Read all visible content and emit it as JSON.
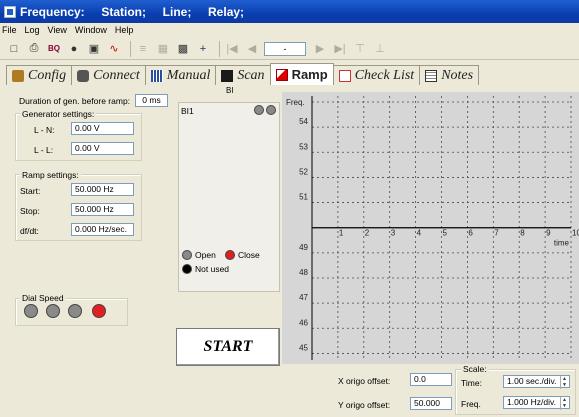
{
  "window": {
    "title": "Frequency:     Station;     Line;     Relay;"
  },
  "menu": [
    "File",
    "Log",
    "View",
    "Window",
    "Help"
  ],
  "toolbar": {
    "field_value": "-"
  },
  "tabs": [
    {
      "label": "Config",
      "icon": "config-icon"
    },
    {
      "label": "Connect",
      "icon": "connect-icon"
    },
    {
      "label": "Manual",
      "icon": "manual-icon"
    },
    {
      "label": "Scan",
      "icon": "scan-icon"
    },
    {
      "label": "Ramp",
      "icon": "ramp-icon",
      "active": true
    },
    {
      "label": "Check List",
      "icon": "checklist-icon"
    },
    {
      "label": "Notes",
      "icon": "notes-icon"
    }
  ],
  "left": {
    "duration_label": "Duration of gen. before ramp:",
    "duration_value": "0 ms",
    "generator_title": "Generator settings:",
    "ln_label": "L - N:",
    "ln_value": "0.00 V",
    "ll_label": "L - L:",
    "ll_value": "0.00 V",
    "ramp_title": "Ramp settings:",
    "start_label": "Start:",
    "start_value": "50.000 Hz",
    "stop_label": "Stop:",
    "stop_value": "50.000 Hz",
    "dfdt_label": "df/dt:",
    "dfdt_value": "0.000 Hz/sec.",
    "dial_title": "Dial Speed"
  },
  "bi": {
    "header": "BI",
    "row_label": "BI1",
    "legend_open": "Open",
    "legend_close": "Close",
    "legend_notused": "Not used"
  },
  "chart": {
    "y_axis_label": "Freq.",
    "x_axis_label": "time",
    "y_ticks": [
      "54",
      "53",
      "52",
      "51",
      "49",
      "48",
      "47",
      "46",
      "45"
    ],
    "x_ticks": [
      "1",
      "2",
      "3",
      "4",
      "5",
      "6",
      "7",
      "8",
      "9",
      "10"
    ],
    "colors": {
      "background": "#d6d6d6",
      "grid": "#4a4a4a",
      "axis": "#000000"
    }
  },
  "start_button": "START",
  "bottom": {
    "x_origo_label": "X origo offset:",
    "x_origo_value": "0.0",
    "y_origo_label": "Y origo offset:",
    "y_origo_value": "50.000",
    "scale_title": "Scale:",
    "time_label": "Time:",
    "time_value": "1.00 sec./div.",
    "freq_label": "Freq.",
    "freq_value": "1.000 Hz/div."
  },
  "colors": {
    "title_bar": "#0a3fb0",
    "close_led": "#e02020",
    "dial_active": "#e02020",
    "dial_inactive": "#8a8a8a"
  }
}
